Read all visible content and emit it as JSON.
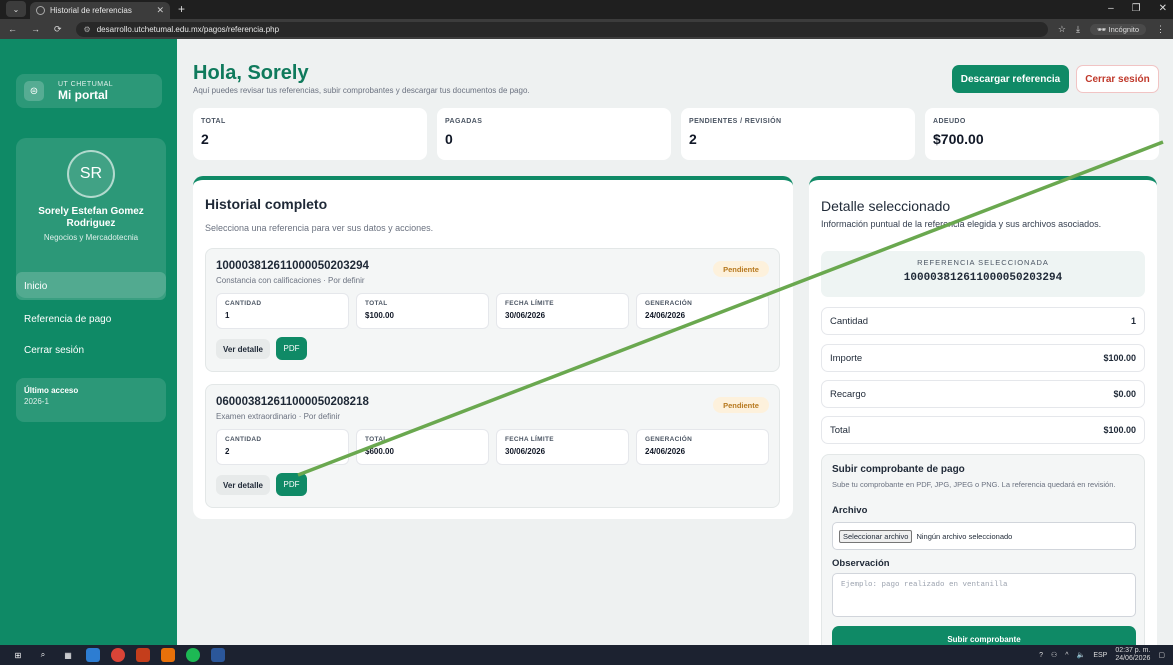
{
  "browser": {
    "tab_title": "Historial de referencias",
    "url": "desarrollo.utchetumal.edu.mx/pagos/referencia.php",
    "incognito_label": "Incógnito"
  },
  "sidebar": {
    "brand_sub": "UT CHETUMAL",
    "brand_title": "Mi portal",
    "avatar_initials": "SR",
    "user_name": "Sorely Estefan Gomez Rodriguez",
    "career": "Negocios y Mercadotecnia",
    "menu": [
      "Inicio",
      "Referencia de pago",
      "Cerrar sesión"
    ],
    "last_access_title": "Último acceso",
    "last_access_value": "2026-1"
  },
  "header": {
    "greeting": "Hola, Sorely",
    "subtitle": "Aquí puedes revisar tus referencias, subir comprobantes y descargar tus documentos de pago.",
    "download_label": "Descargar referencia",
    "logout_label": "Cerrar sesión"
  },
  "stats": [
    {
      "label": "TOTAL",
      "value": "2"
    },
    {
      "label": "PAGADAS",
      "value": "0"
    },
    {
      "label": "PENDIENTES / REVISIÓN",
      "value": "2"
    },
    {
      "label": "ADEUDO",
      "value": "$700.00"
    }
  ],
  "history": {
    "title": "Historial completo",
    "subtitle": "Selecciona una referencia para ver sus datos y acciones.",
    "field_labels": [
      "CANTIDAD",
      "TOTAL",
      "FECHA LÍMITE",
      "GENERACIÓN"
    ],
    "detail_label": "Ver detalle",
    "pdf_label": "PDF",
    "items": [
      {
        "reference": "10000381261100005020329​4",
        "concept": "Constancia con calificaciones · Por definir",
        "status": "Pendiente",
        "values": [
          "1",
          "$100.00",
          "30/06/2026",
          "24/06/2026"
        ]
      },
      {
        "reference": "060003812611000050208218",
        "concept": "Examen extraordinario · Por definir",
        "status": "Pendiente",
        "values": [
          "2",
          "$600.00",
          "30/06/2026",
          "24/06/2026"
        ]
      }
    ]
  },
  "detail": {
    "title": "Detalle seleccionado",
    "subtitle": "Información puntual de la referencia elegida y sus archivos asociados.",
    "selected_label": "REFERENCIA SELECCIONADA",
    "selected_value": "100003812611000050203294",
    "rows": [
      {
        "label": "Cantidad",
        "value": "1"
      },
      {
        "label": "Importe",
        "value": "$100.00"
      },
      {
        "label": "Recargo",
        "value": "$0.00"
      },
      {
        "label": "Total",
        "value": "$100.00"
      }
    ],
    "upload": {
      "title": "Subir comprobante de pago",
      "subtitle": "Sube tu comprobante en PDF, JPG, JPEG o PNG. La referencia quedará en revisión.",
      "file_label": "Archivo",
      "file_button": "Seleccionar archivo",
      "file_status": "Ningún archivo seleccionado",
      "obs_label": "Observación",
      "obs_placeholder": "Ejemplo: pago realizado en ventanilla",
      "submit_label": "Subir comprobante"
    }
  },
  "taskbar": {
    "lang": "ESP",
    "time": "02:37 p. m.",
    "date": "24/06/2026"
  }
}
